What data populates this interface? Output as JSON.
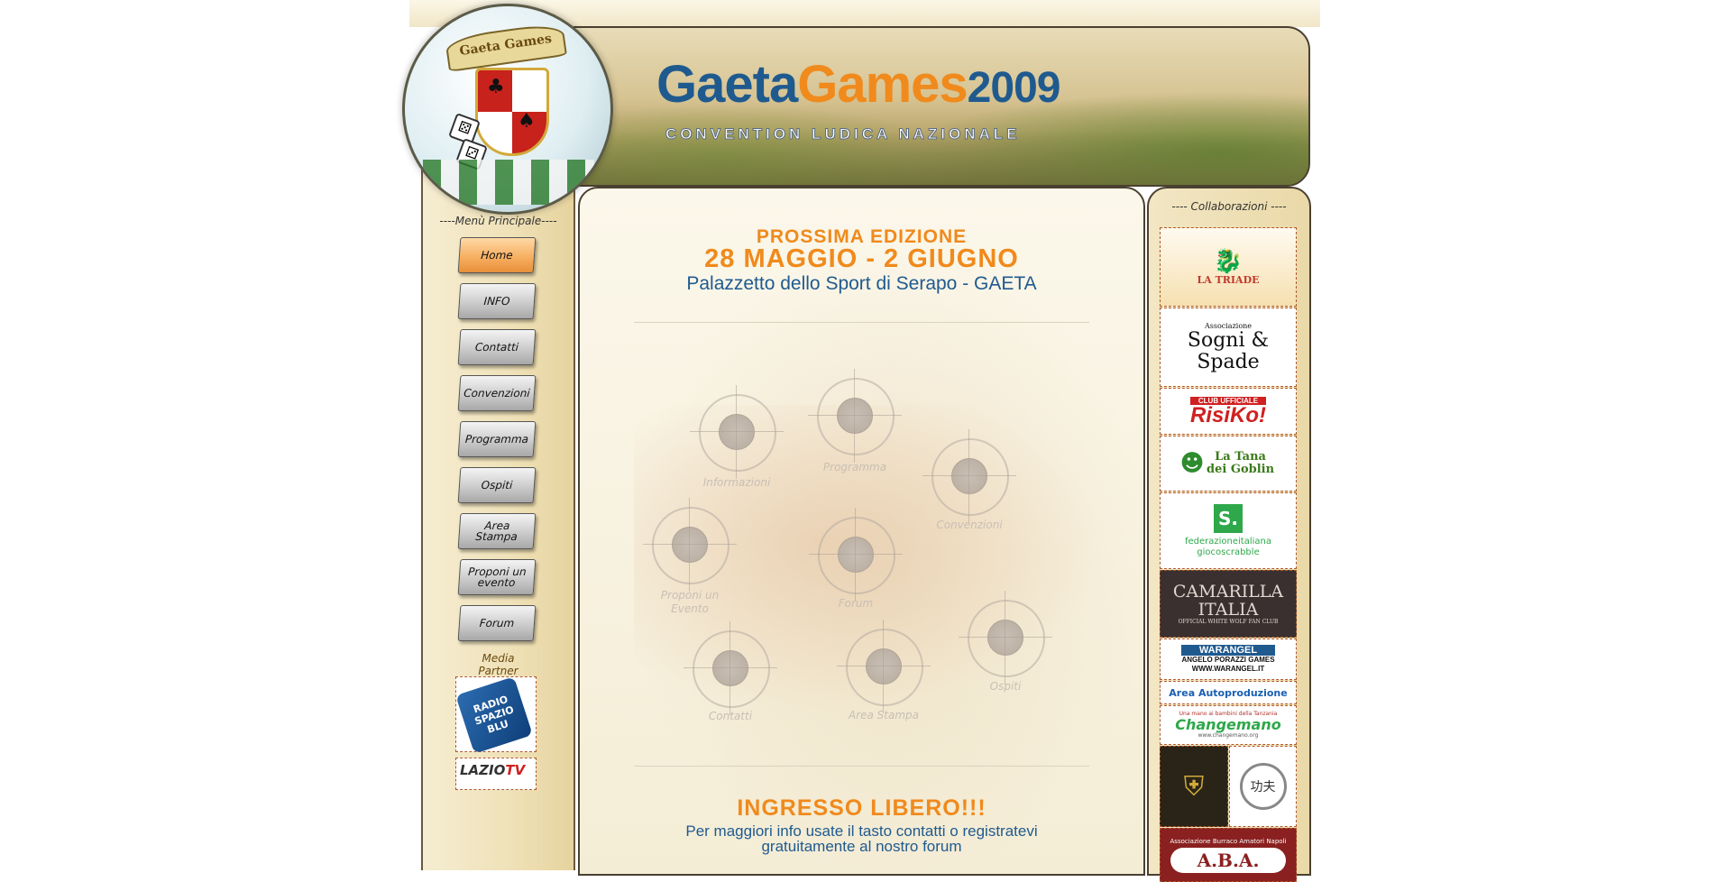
{
  "header": {
    "logo_text": "Gaeta Games",
    "banner_title_part1": "Gaeta",
    "banner_title_part2": "Games",
    "banner_title_year": "2009",
    "banner_subtitle": "CONVENTION LUDICA NAZIONALE"
  },
  "menu": {
    "heading": "----Menù Principale----",
    "items": [
      {
        "label": "Home",
        "active": true
      },
      {
        "label": "INFO"
      },
      {
        "label": "Contatti"
      },
      {
        "label": "Convenzioni"
      },
      {
        "label": "Programma"
      },
      {
        "label": "Ospiti"
      },
      {
        "label": "Area Stampa"
      },
      {
        "label": "Proponi un evento"
      },
      {
        "label": "Forum"
      }
    ],
    "media_heading": "Media Partner",
    "media_partners": [
      {
        "name": "Radio Spazio Blu",
        "text": "RADIO SPAZIO BLU"
      },
      {
        "name": "Lazio TV",
        "text_a": "LAZIO",
        "text_b": "TV"
      }
    ]
  },
  "main": {
    "next_edition": "PROSSIMA EDIZIONE",
    "dates": "28 MAGGIO - 2 GIUGNO",
    "venue": "Palazzetto dello Sport di Serapo - GAETA",
    "targets": [
      {
        "label": "Informazioni"
      },
      {
        "label": "Programma"
      },
      {
        "label": "Convenzioni"
      },
      {
        "label": "Proponi un Evento"
      },
      {
        "label": "Forum"
      },
      {
        "label": "Ospiti"
      },
      {
        "label": "Contatti"
      },
      {
        "label": "Area Stampa"
      }
    ],
    "free_entry": "INGRESSO LIBERO!!!",
    "info_line1": "Per maggiori info usate il tasto contatti o registratevi",
    "info_line2": "gratuitamente al nostro forum"
  },
  "collab": {
    "heading": "---- Collaborazioni ----",
    "sponsors": [
      {
        "name": "La Triade",
        "text": "LA TRIADE"
      },
      {
        "name": "Sogni & Spade",
        "text_small": "Associazione",
        "text": "Sogni & Spade"
      },
      {
        "name": "RisiKo! Club Ufficiale",
        "text_small": "CLUB UFFICIALE",
        "text": "RisiKo!"
      },
      {
        "name": "La Tana dei Goblin",
        "text": "La Tana dei Goblin"
      },
      {
        "name": "Federazione Italiana Gioco Scrabble",
        "text_small": "S.",
        "text": "federazioneitaliana giocoscrabble"
      },
      {
        "name": "Camarilla Italia",
        "text": "CAMARILLA ITALIA",
        "text_small": "OFFICIAL WHITE WOLF FAN CLUB"
      },
      {
        "name": "WarAngel",
        "text": "WARANGEL",
        "text_small": "ANGELO PORAZZI GAMES",
        "text_url": "WWW.WARANGEL.IT"
      },
      {
        "name": "Area Autoproduzione",
        "text": "Area Autoproduzione"
      },
      {
        "name": "Changemano Onlus",
        "text_small": "Una mano ai bambini della Tanzania",
        "text": "Changemano",
        "text_url": "www.changemano.org"
      },
      {
        "name": "Kung Fu association",
        "text": "功夫"
      },
      {
        "name": "A.B.A.",
        "text_small": "Associazione Burraco Amatori Napoli",
        "text": "A.B.A."
      }
    ]
  },
  "colors": {
    "orange": "#f08a1c",
    "blue": "#1f5a8f",
    "border": "#4a4030"
  }
}
